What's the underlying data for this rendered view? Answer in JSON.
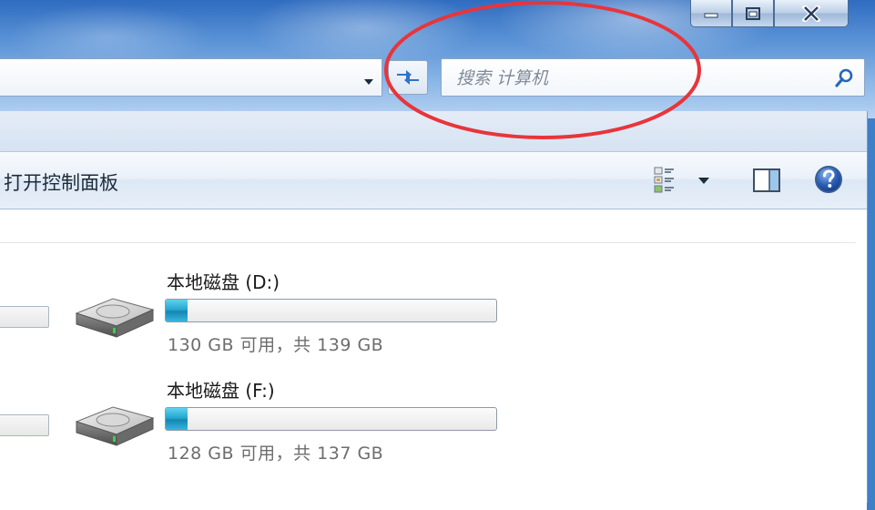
{
  "search": {
    "placeholder": "搜索 计算机"
  },
  "toolbar": {
    "open_control_panel_label": "打开控制面板"
  },
  "drives": [
    {
      "name": "本地磁盘 (D:)",
      "info": "130 GB 可用，共 139 GB",
      "used_fraction": 0.065
    },
    {
      "name": "本地磁盘 (F:)",
      "info": "128 GB 可用，共 137 GB",
      "used_fraction": 0.066
    }
  ],
  "icons": [
    "minimize-icon",
    "maximize-icon",
    "close-icon",
    "dropdown-arrow-icon",
    "refresh-icon",
    "search-icon",
    "change-view-icon",
    "preview-pane-icon",
    "help-icon",
    "hard-drive-icon"
  ],
  "colors": {
    "annotation": "#e8353b",
    "drive_bar_fill": "#26a7cf",
    "glass": "#5b93d6"
  }
}
